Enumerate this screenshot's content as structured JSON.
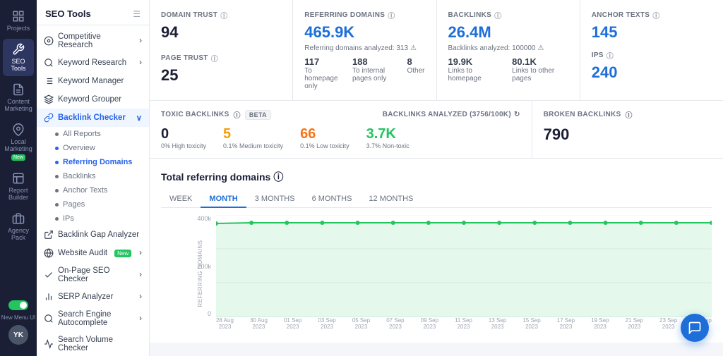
{
  "icon_sidebar": {
    "items": [
      {
        "id": "projects",
        "label": "Projects",
        "icon": "grid"
      },
      {
        "id": "seo-tools",
        "label": "SEO Tools",
        "icon": "wrench",
        "active": true
      },
      {
        "id": "content-marketing",
        "label": "Content Marketing",
        "icon": "document"
      },
      {
        "id": "local-marketing",
        "label": "Local Marketing",
        "icon": "map-pin",
        "badge": "New"
      },
      {
        "id": "report-builder",
        "label": "Report Builder",
        "icon": "chart"
      },
      {
        "id": "agency-pack",
        "label": "Agency Pack",
        "icon": "briefcase"
      }
    ],
    "new_menu_label": "New Menu UI",
    "avatar": "YK"
  },
  "main_sidebar": {
    "title": "SEO Tools",
    "items": [
      {
        "id": "competitive-research",
        "label": "Competitive Research",
        "icon": "target",
        "has_chevron": true
      },
      {
        "id": "keyword-research",
        "label": "Keyword Research",
        "icon": "search",
        "has_chevron": true
      },
      {
        "id": "keyword-manager",
        "label": "Keyword Manager",
        "icon": "list"
      },
      {
        "id": "keyword-grouper",
        "label": "Keyword Grouper",
        "icon": "layers"
      },
      {
        "id": "backlink-checker",
        "label": "Backlink Checker",
        "icon": "link",
        "active": true,
        "has_chevron": true,
        "sub_items": [
          {
            "id": "all-reports",
            "label": "All Reports"
          },
          {
            "id": "overview",
            "label": "Overview",
            "active": false
          },
          {
            "id": "referring-domains",
            "label": "Referring Domains",
            "active": true
          },
          {
            "id": "backlinks",
            "label": "Backlinks"
          },
          {
            "id": "anchor-texts",
            "label": "Anchor Texts"
          },
          {
            "id": "pages",
            "label": "Pages"
          },
          {
            "id": "ips",
            "label": "IPs"
          }
        ]
      },
      {
        "id": "backlink-gap-analyzer",
        "label": "Backlink Gap Analyzer",
        "icon": "gap"
      },
      {
        "id": "website-audit",
        "label": "Website Audit",
        "icon": "globe",
        "badge": "New",
        "has_chevron": true
      },
      {
        "id": "on-page-seo",
        "label": "On-Page SEO Checker",
        "icon": "check",
        "has_chevron": true
      },
      {
        "id": "serp-analyzer",
        "label": "SERP Analyzer",
        "icon": "bar-chart",
        "has_chevron": true
      },
      {
        "id": "search-engine-autocomplete",
        "label": "Search Engine Autocomplete",
        "icon": "magnifier",
        "has_chevron": true
      },
      {
        "id": "search-volume",
        "label": "Search Volume Checker",
        "icon": "volume"
      }
    ]
  },
  "stats": {
    "domain_trust": {
      "label": "DOMAIN TRUST",
      "value": "94"
    },
    "referring_domains": {
      "label": "REFERRING DOMAINS",
      "value": "465.9K",
      "sub_text": "Referring domains analyzed: 313",
      "sub_items": [
        {
          "value": "117",
          "label": "To homepage only"
        },
        {
          "value": "188",
          "label": "To internal pages only"
        },
        {
          "value": "8",
          "label": "Other"
        }
      ]
    },
    "backlinks": {
      "label": "BACKLINKS",
      "value": "26.4M",
      "sub_text": "Backlinks analyzed: 100000",
      "sub_items": [
        {
          "value": "19.9K",
          "label": "Links to homepage"
        },
        {
          "value": "80.1K",
          "label": "Links to other pages"
        }
      ]
    },
    "anchor_texts": {
      "label": "ANCHOR TEXTS",
      "value": "145",
      "ips_label": "IPS",
      "ips_value": "240"
    },
    "page_trust": {
      "label": "PAGE TRUST",
      "value": "25"
    }
  },
  "toxic": {
    "label": "TOXIC BACKLINKS",
    "beta": "BETA",
    "analyzed_text": "Backlinks analyzed (3756/100K)",
    "values": [
      {
        "num": "0",
        "sub": "0% High toxicity",
        "color": "black"
      },
      {
        "num": "5",
        "sub": "0.1% Medium toxicity",
        "color": "yellow"
      },
      {
        "num": "66",
        "sub": "0.1% Low toxicity",
        "color": "orange"
      },
      {
        "num": "3.7K",
        "sub": "3.7% Non-toxic",
        "color": "green"
      }
    ],
    "broken_label": "BROKEN BACKLINKS",
    "broken_value": "790"
  },
  "chart": {
    "title": "Total referring domains",
    "tabs": [
      "WEEK",
      "MONTH",
      "3 MONTHS",
      "6 MONTHS",
      "12 MONTHS"
    ],
    "active_tab": "MONTH",
    "y_axis_label": "REFERRING DOMAINS",
    "y_labels": [
      "400k",
      "200k",
      "0"
    ],
    "x_labels": [
      {
        "date": "28 Aug",
        "year": "2023"
      },
      {
        "date": "30 Aug",
        "year": "2023"
      },
      {
        "date": "01 Sep",
        "year": "2023"
      },
      {
        "date": "03 Sep",
        "year": "2023"
      },
      {
        "date": "05 Sep",
        "year": "2023"
      },
      {
        "date": "07 Sep",
        "year": "2023"
      },
      {
        "date": "09 Sep",
        "year": "2023"
      },
      {
        "date": "11 Sep",
        "year": "2023"
      },
      {
        "date": "13 Sep",
        "year": "2023"
      },
      {
        "date": "15 Sep",
        "year": "2023"
      },
      {
        "date": "17 Sep",
        "year": "2023"
      },
      {
        "date": "19 Sep",
        "year": "2023"
      },
      {
        "date": "21 Sep",
        "year": "2023"
      },
      {
        "date": "23 Sep",
        "year": "2023"
      },
      {
        "date": "25 Sep",
        "year": "2023"
      }
    ],
    "line_color": "#22c55e",
    "fill_color": "rgba(34,197,94,0.12)"
  }
}
